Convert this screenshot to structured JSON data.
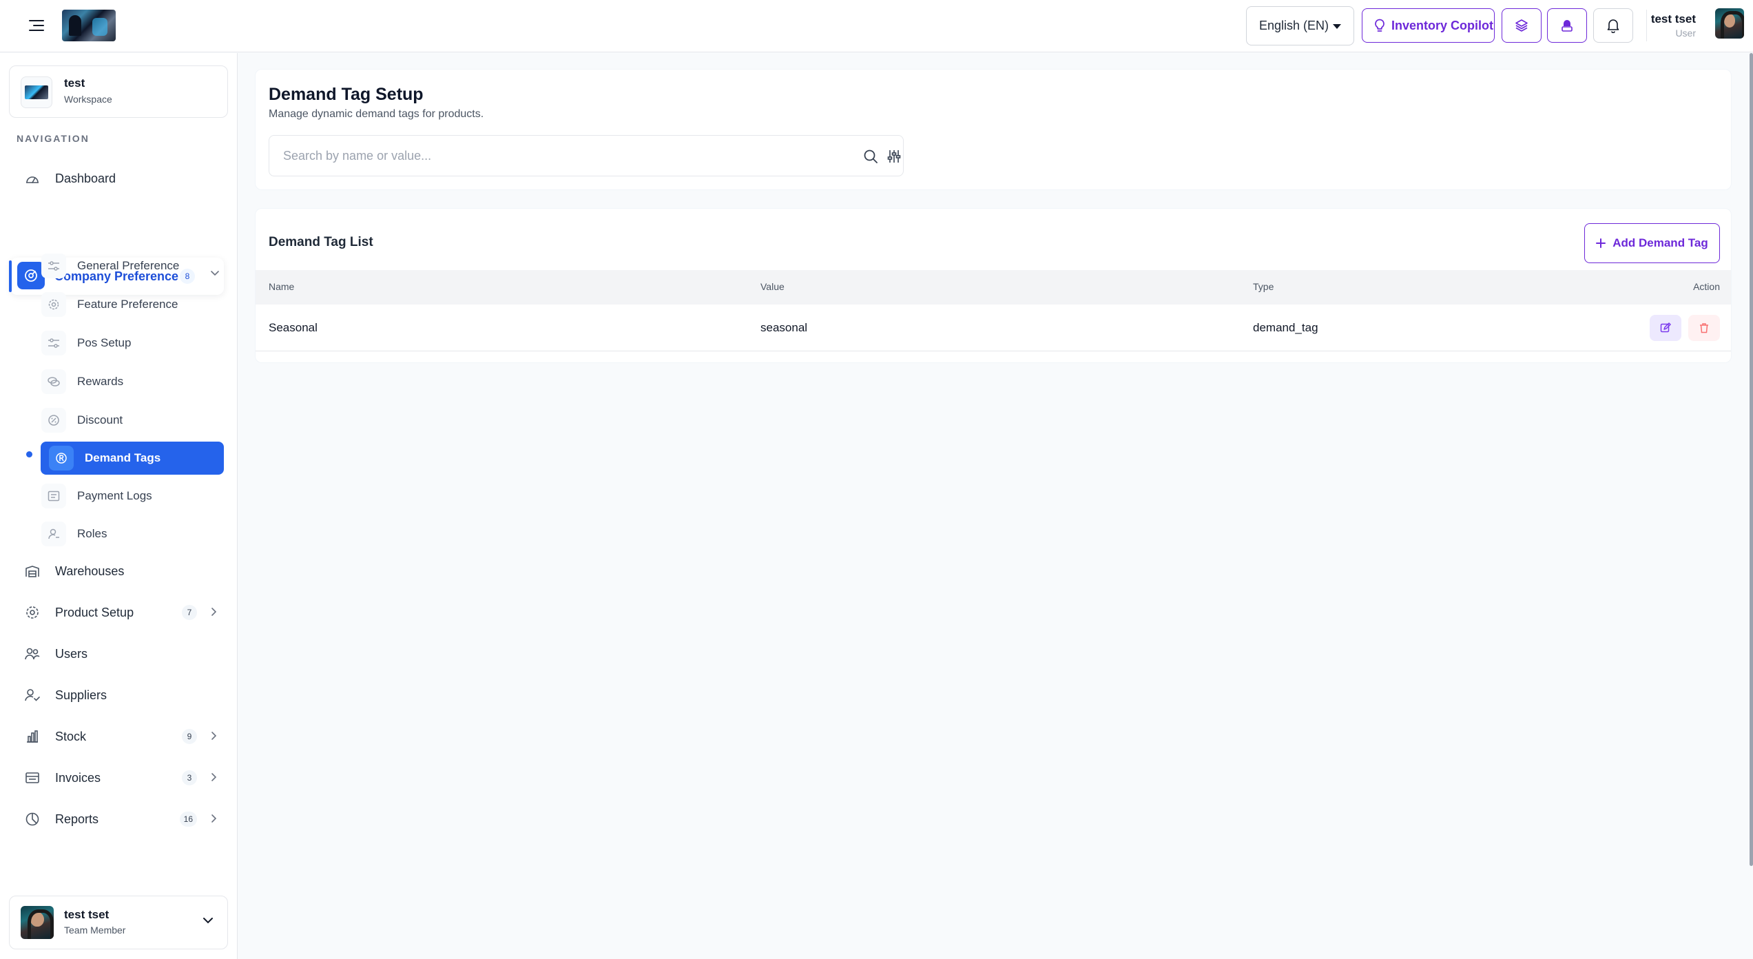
{
  "topbar": {
    "language": "English (EN)",
    "copilot_label": "Inventory Copilot",
    "user_name": "test tset",
    "user_role": "User",
    "accent": "#6d28d9"
  },
  "sidebar": {
    "workspace_name": "test",
    "workspace_label": "Workspace",
    "nav_heading": "NAVIGATION",
    "items": [
      {
        "label": "Dashboard",
        "icon": "gauge-icon"
      },
      {
        "label": "Company Preference",
        "icon": "settings-icon",
        "badge": "8",
        "expanded": true
      },
      {
        "label": "Warehouses",
        "icon": "warehouse-icon"
      },
      {
        "label": "Product Setup",
        "icon": "gear-icon",
        "badge": "7"
      },
      {
        "label": "Users",
        "icon": "users-icon"
      },
      {
        "label": "Suppliers",
        "icon": "user-check-icon"
      },
      {
        "label": "Stock",
        "icon": "bar-chart-icon",
        "badge": "9"
      },
      {
        "label": "Invoices",
        "icon": "invoice-icon",
        "badge": "3"
      },
      {
        "label": "Reports",
        "icon": "pie-chart-icon",
        "badge": "16"
      }
    ],
    "sub_items": [
      {
        "label": "General Preference",
        "icon": "sliders-icon"
      },
      {
        "label": "Feature Preference",
        "icon": "gear-icon"
      },
      {
        "label": "Pos Setup",
        "icon": "sliders-icon"
      },
      {
        "label": "Rewards",
        "icon": "coins-icon"
      },
      {
        "label": "Discount",
        "icon": "percent-icon"
      },
      {
        "label": "Demand Tags",
        "icon": "registered-icon",
        "active": true
      },
      {
        "label": "Payment Logs",
        "icon": "log-icon"
      },
      {
        "label": "Roles",
        "icon": "user-key-icon"
      }
    ],
    "footer_user": {
      "name": "test tset",
      "role": "Team Member"
    },
    "active_color": "#2563eb"
  },
  "page": {
    "title": "Demand Tag Setup",
    "subtitle": "Manage dynamic demand tags for products.",
    "search_placeholder": "Search by name or value..."
  },
  "list": {
    "title": "Demand Tag List",
    "add_label": "Add Demand Tag",
    "columns": [
      "Name",
      "Value",
      "Type",
      "Action"
    ],
    "rows": [
      {
        "name": "Seasonal",
        "value": "seasonal",
        "type": "demand_tag"
      }
    ]
  }
}
